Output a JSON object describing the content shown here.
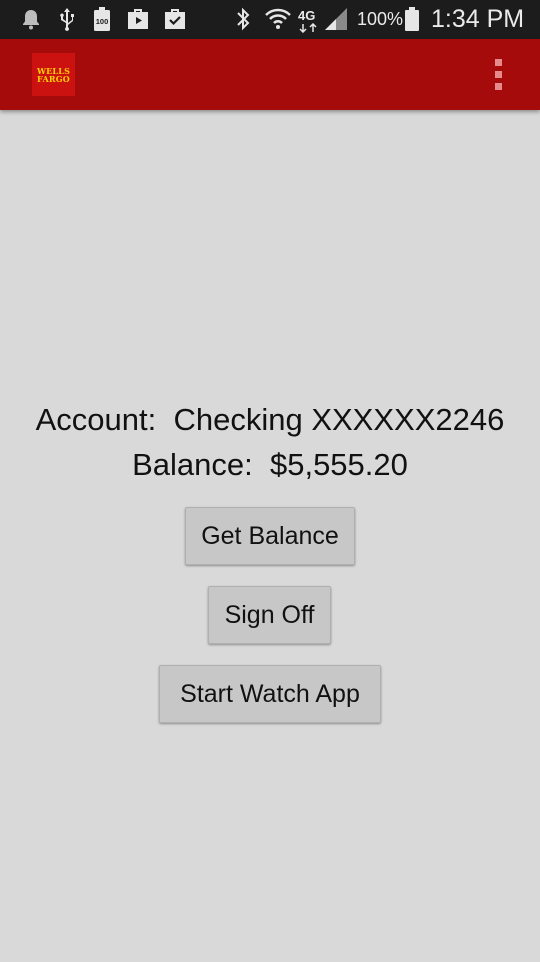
{
  "status_bar": {
    "time": "1:34 PM",
    "battery_percent": "100%",
    "network": "4G",
    "battery_badge": "100",
    "icons": [
      "notification-bell-icon",
      "usb-icon",
      "battery-100-icon",
      "play-store-icon",
      "task-check-icon",
      "bluetooth-icon",
      "wifi-icon",
      "lte-icon",
      "signal-icon",
      "battery-icon"
    ]
  },
  "app_bar": {
    "logo_line1": "WELLS",
    "logo_line2": "FARGO",
    "brand_color": "#a60b0b",
    "menu_icon": "overflow-menu-icon"
  },
  "account": {
    "account_text": "Account:  Checking XXXXXX2246",
    "balance_text": "Balance:  $5,555.20"
  },
  "buttons": {
    "get_balance": "Get Balance",
    "sign_off": "Sign Off",
    "start_watch_app": "Start Watch App"
  }
}
